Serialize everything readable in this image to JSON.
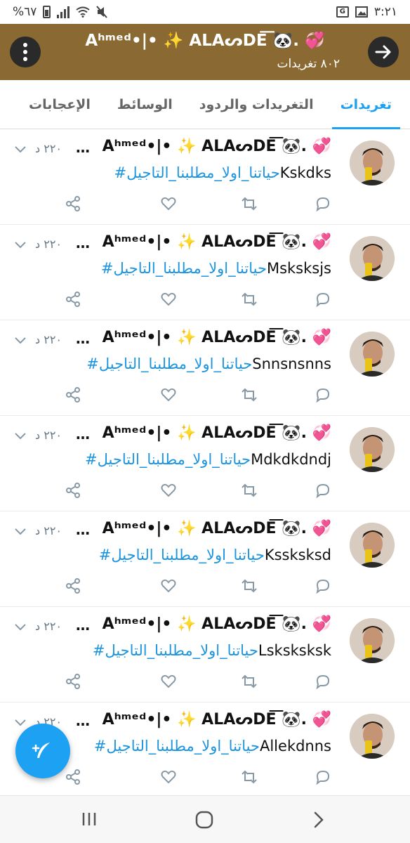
{
  "status_bar": {
    "time": "٣:٢١",
    "battery_percent": "%٦٧",
    "icons": [
      "battery-icon",
      "signal-icon",
      "wifi-icon",
      "mute-icon",
      "gallery-icon",
      "translate-icon"
    ]
  },
  "header": {
    "title": "Aʰᵐᵉᵈ•|• ✨ ALAᔕDE͞͞ 🐼. 💞",
    "subtitle": "٨٠٢ تغريدات",
    "colors": {
      "bg": "#8a6a32",
      "button": "#2a2a2a"
    }
  },
  "tabs": [
    {
      "label": "تغريدات",
      "active": true
    },
    {
      "label": "التغريدات والردود",
      "active": false
    },
    {
      "label": "الوسائط",
      "active": false
    },
    {
      "label": "الإعجابات",
      "active": false
    }
  ],
  "accent_color": "#1da1f2",
  "tweets": [
    {
      "name": "Aʰᵐᵉᵈ•|• ✨ ALAᔕDE͞͞ 🐼. 💞",
      "time": "٢٢٠ د",
      "hashtag": "#حياتنا_اولا_مطلبنا_التاجيل",
      "text": "Kskdks"
    },
    {
      "name": "Aʰᵐᵉᵈ•|• ✨ ALAᔕDE͞͞ 🐼. 💞",
      "time": "٢٢٠ د",
      "hashtag": "#حياتنا_اولا_مطلبنا_التاجيل",
      "text": "Msksksjs"
    },
    {
      "name": "Aʰᵐᵉᵈ•|• ✨ ALAᔕDE͞͞ 🐼. 💞",
      "time": "٢٢٠ د",
      "hashtag": "#حياتنا_اولا_مطلبنا_التاجيل",
      "text": "Snnsnsnns"
    },
    {
      "name": "Aʰᵐᵉᵈ•|• ✨ ALAᔕDE͞͞ 🐼. 💞",
      "time": "٢٢٠ د",
      "hashtag": "#حياتنا_اولا_مطلبنا_التاجيل",
      "text": "Mdkdkdndj"
    },
    {
      "name": "Aʰᵐᵉᵈ•|• ✨ ALAᔕDE͞͞ 🐼. 💞",
      "time": "٢٢٠ د",
      "hashtag": "#حياتنا_اولا_مطلبنا_التاجيل",
      "text": "Kssksksd"
    },
    {
      "name": "Aʰᵐᵉᵈ•|• ✨ ALAᔕDE͞͞ 🐼. 💞",
      "time": "٢٢٠ د",
      "hashtag": "#حياتنا_اولا_مطلبنا_التاجيل",
      "text": "Lsksksksk"
    },
    {
      "name": "Aʰᵐᵉᵈ•|• ✨ ALAᔕDE͞͞ 🐼. 💞",
      "time": "٢٢٠ د",
      "hashtag": "#حياتنا_اولا_مطلبنا_التاجيل",
      "text": "Allekdnns"
    }
  ],
  "fab_icon": "compose-tweet-icon",
  "nav_buttons": [
    "recent-apps-icon",
    "home-icon",
    "back-icon"
  ]
}
